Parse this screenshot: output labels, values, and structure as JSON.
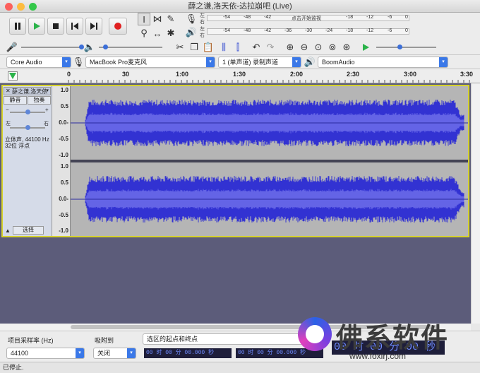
{
  "window": {
    "title": "薛之谦,洛天依-达拉崩吧 (Live)"
  },
  "meters": {
    "rec_channels": [
      "左",
      "右"
    ],
    "play_channels": [
      "左",
      "右"
    ],
    "rec_ticks": [
      "-54",
      "-48",
      "-42",
      "点击开始监视",
      "-18",
      "-12",
      "-6",
      "0"
    ],
    "play_ticks": [
      "-54",
      "-48",
      "-42",
      "-36",
      "-30",
      "-24",
      "-18",
      "-12",
      "-6",
      "0"
    ]
  },
  "devices": {
    "host": "Core Audio",
    "input": "MacBook Pro麦克风",
    "channels": "1 (单声道) 录制声道",
    "output": "BoomAudio"
  },
  "ruler": {
    "labels": [
      "0",
      "30",
      "1:00",
      "1:30",
      "2:00",
      "2:30",
      "3:00",
      "3:30"
    ]
  },
  "track": {
    "name": "薛之谦,洛天依",
    "mute": "静音",
    "solo": "独奏",
    "pan_left": "左",
    "pan_right": "右",
    "info_line1": "立体声, 44100 Hz",
    "info_line2": "32位 浮点",
    "select": "选择",
    "scale": [
      "1.0",
      "0.5",
      "0.0-",
      "-0.5",
      "-1.0"
    ]
  },
  "selection": {
    "rate_label": "项目采样率 (Hz)",
    "rate_value": "44100",
    "snap_label": "吸附到",
    "snap_value": "关闭",
    "mode_value": "选区的起点和终点",
    "start_time": "00 时 00 分 00.000 秒",
    "end_time": "00 时 00 分 00.000 秒",
    "big_time": "00 时 00 分 00 秒"
  },
  "status": {
    "text": "已停止."
  },
  "watermark": {
    "text": "佛系软件",
    "url": "www.foxirj.com"
  },
  "colors": {
    "waveform": "#3232d2",
    "rms": "#6464e6",
    "track_border": "#d6d22c",
    "accent": "#3a78e8"
  }
}
